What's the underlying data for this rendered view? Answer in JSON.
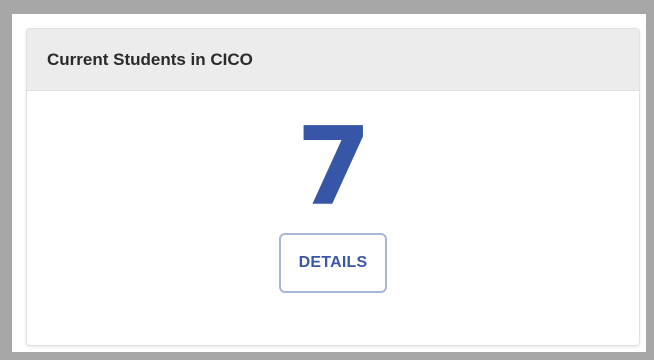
{
  "widget": {
    "title": "Current Students in CICO",
    "count": "7",
    "details_label": "DETAILS"
  },
  "colors": {
    "accent": "#3856a8",
    "header_bg": "#ececec",
    "frame_border": "#a8a7a7",
    "button_border": "#a9b6d8"
  }
}
